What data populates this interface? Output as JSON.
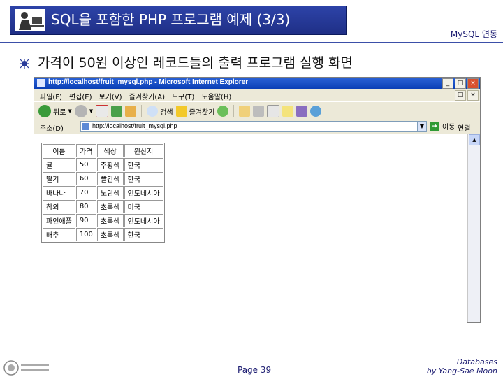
{
  "slide": {
    "title": "SQL을 포함한 PHP 프로그램 예제 (3/3)",
    "header_right": "MySQL 연동",
    "bullet": "가격이 50원 이상인 레코드들의 출력 프로그램 실행 화면",
    "page": "Page 39",
    "footer_line1": "Databases",
    "footer_line2": "by Yang-Sae Moon"
  },
  "browser": {
    "title": "http://localhost/fruit_mysql.php - Microsoft Internet Explorer",
    "menu": [
      "파일(F)",
      "편집(E)",
      "보기(V)",
      "즐겨찾기(A)",
      "도구(T)",
      "도움말(H)"
    ],
    "toolbar": {
      "back": "뒤로",
      "search": "검색",
      "favorites": "즐겨찾기"
    },
    "address_label": "주소(D)",
    "address": "http://localhost/fruit_mysql.php",
    "go": "이동",
    "links": "연결"
  },
  "table": {
    "headers": [
      "이름",
      "가격",
      "색상",
      "원산지"
    ],
    "rows": [
      [
        "귤",
        "50",
        "주황색",
        "한국"
      ],
      [
        "딸기",
        "60",
        "빨간색",
        "한국"
      ],
      [
        "바나나",
        "70",
        "노란색",
        "인도네시아"
      ],
      [
        "참외",
        "80",
        "초록색",
        "미국"
      ],
      [
        "파인애플",
        "90",
        "초록색",
        "인도네시아"
      ],
      [
        "배추",
        "100",
        "초록색",
        "한국"
      ]
    ]
  },
  "colors": {
    "title_bar": "#1f2f86",
    "xp_titlebar": "#0a3fb6"
  }
}
